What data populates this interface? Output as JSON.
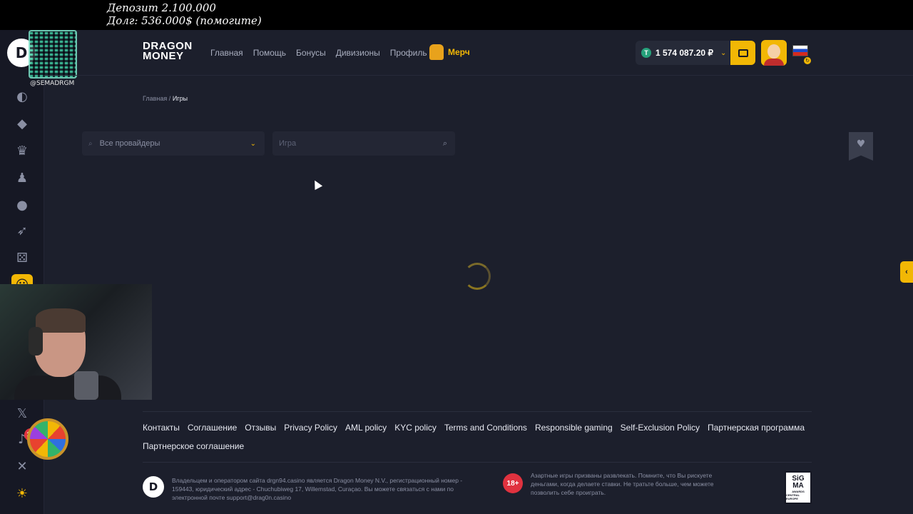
{
  "overlay": {
    "deposit": "Депозит 2.100.000",
    "debt": "Долг: 536.000$ (помогите)"
  },
  "qr_label": "@SEMADRGM",
  "notifications": {
    "count": "30"
  },
  "header": {
    "brand_line1": "DRAGON",
    "brand_line2": "MONEY",
    "nav": [
      "Главная",
      "Помощь",
      "Бонусы",
      "Дивизионы",
      "Профиль"
    ],
    "merch": "Мерч",
    "balance": "1 574 087.20 ₽"
  },
  "breadcrumb": {
    "home": "Главная",
    "separator": "/",
    "current": "Игры"
  },
  "filters": {
    "provider_label": "Все провайдеры",
    "search_placeholder": "Игра"
  },
  "footer": {
    "links": [
      "Контакты",
      "Соглашение",
      "Отзывы",
      "Privacy Policy",
      "AML policy",
      "KYC policy",
      "Terms and Conditions",
      "Responsible gaming",
      "Self-Exclusion Policy",
      "Партнерская программа",
      "Партнерское соглашение"
    ],
    "legal": "Владельцем и оператором сайта drgn94.casino является Dragon Money N.V., регистрационный номер - 159443, юридический адрес - Chuchubiweg 17, Willemstad, Curaçao. Вы можете связаться с нами по электронной почте support@drag0n.casino",
    "age": "18+",
    "gamble_notice": "Азартные игры призваны развлекать. Помните, что Вы рискуете деньгами, когда делаете ставки. Не тратьте больше, чем можете позволить себе проиграть.",
    "sigma_line1": "SiG",
    "sigma_line2": "MA",
    "sigma_line3": "AWARDS",
    "sigma_line4": "CENTRAL EUROPE"
  },
  "colors": {
    "accent": "#f2b705",
    "background": "#1c1f2c",
    "sidebar": "#161824",
    "danger": "#e0323f"
  },
  "icons": [
    "dragon-logo-icon",
    "gamepad-icon",
    "ticket-icon",
    "trophy-icon",
    "user-icon",
    "rocket-icon",
    "dice-icon",
    "x-icon",
    "bell-icon",
    "mute-icon",
    "sun-icon",
    "wallet-icon",
    "search-icon",
    "chevron-down-icon",
    "heart-icon",
    "chevron-left-icon"
  ]
}
